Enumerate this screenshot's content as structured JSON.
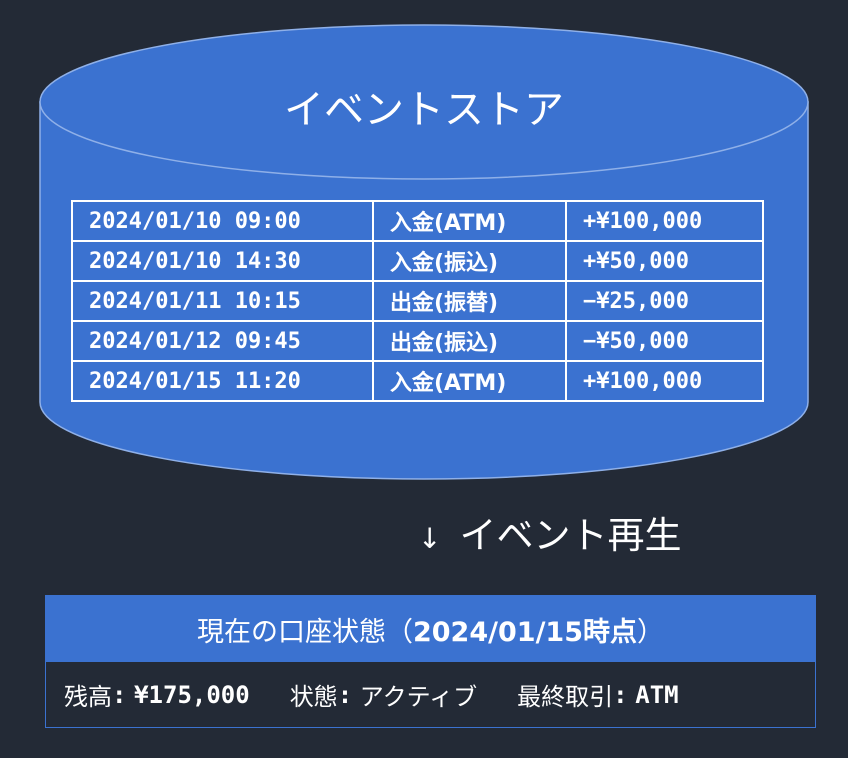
{
  "event_store": {
    "title": "イベントストア",
    "events": [
      {
        "time": "2024/01/10 09:00",
        "type": "入金(ATM)",
        "amount": "+¥100,000"
      },
      {
        "time": "2024/01/10 14:30",
        "type": "入金(振込)",
        "amount": "+¥50,000"
      },
      {
        "time": "2024/01/11 10:15",
        "type": "出金(振替)",
        "amount": "−¥25,000"
      },
      {
        "time": "2024/01/12 09:45",
        "type": "出金(振込)",
        "amount": "−¥50,000"
      },
      {
        "time": "2024/01/15 11:20",
        "type": "入金(ATM)",
        "amount": "+¥100,000"
      }
    ]
  },
  "replay": {
    "arrow": "↓",
    "label": "イベント再生"
  },
  "state": {
    "header_prefix": "現在の口座状態",
    "header_paren_open": "（",
    "header_date": "2024/01/15時点",
    "header_paren_close": "）",
    "balance_label": "残高",
    "balance_value": "¥175,000",
    "status_label": "状態",
    "status_value": "アクティブ",
    "last_label": "最終取引",
    "last_value": "ATM",
    "separator": ":"
  },
  "colors": {
    "background": "#232a36",
    "cylinder_fill": "#3b72d0",
    "cylinder_stroke": "#8fb0e8",
    "text": "#ffffff"
  }
}
